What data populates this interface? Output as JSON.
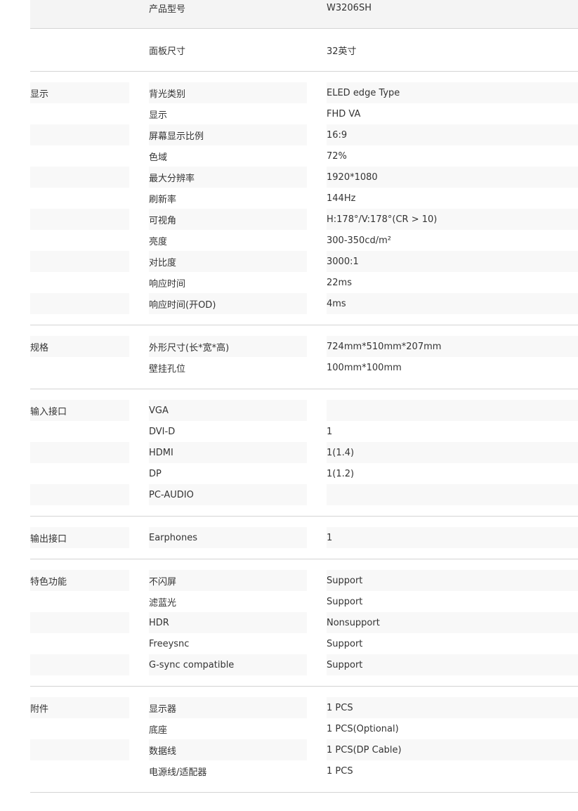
{
  "sections": [
    {
      "kind": "top",
      "label": "",
      "rows": [
        {
          "name": "产品型号",
          "value": "W3206SH"
        }
      ]
    },
    {
      "kind": "panel",
      "label": "",
      "rows": [
        {
          "name": "面板尺寸",
          "value": "32英寸"
        }
      ]
    },
    {
      "kind": "normal",
      "label": "显示",
      "rows": [
        {
          "name": "背光类别",
          "value": "ELED edge Type"
        },
        {
          "name": "显示",
          "value": "FHD VA"
        },
        {
          "name": "屏幕显示比例",
          "value": "16:9"
        },
        {
          "name": "色域",
          "value": "72%"
        },
        {
          "name": "最大分辨率",
          "value": "1920*1080"
        },
        {
          "name": "刷新率",
          "value": "144Hz"
        },
        {
          "name": "可视角",
          "value": "H:178°/V:178°(CR > 10)"
        },
        {
          "name": "亮度",
          "value": "300-350cd/m²"
        },
        {
          "name": "对比度",
          "value": "3000:1"
        },
        {
          "name": "响应时间",
          "value": "22ms"
        },
        {
          "name": "响应时间(开OD)",
          "value": "4ms"
        }
      ]
    },
    {
      "kind": "normal",
      "label": "规格",
      "rows": [
        {
          "name": "外形尺寸(长*宽*高)",
          "value": "724mm*510mm*207mm"
        },
        {
          "name": "壁挂孔位",
          "value": "100mm*100mm"
        }
      ]
    },
    {
      "kind": "normal",
      "label": "输入接口",
      "rows": [
        {
          "name": "VGA",
          "value": ""
        },
        {
          "name": "DVI-D",
          "value": "1"
        },
        {
          "name": "HDMI",
          "value": "1(1.4)"
        },
        {
          "name": "DP",
          "value": "1(1.2)"
        },
        {
          "name": "PC-AUDIO",
          "value": ""
        }
      ]
    },
    {
      "kind": "normal",
      "label": "输出接口",
      "rows": [
        {
          "name": "Earphones",
          "value": "1"
        }
      ]
    },
    {
      "kind": "normal",
      "label": "特色功能",
      "rows": [
        {
          "name": "不闪屏",
          "value": "Support"
        },
        {
          "name": "滤蓝光",
          "value": "Support"
        },
        {
          "name": "HDR",
          "value": "Nonsupport"
        },
        {
          "name": "Freeysnc",
          "value": "Support"
        },
        {
          "name": "G-sync compatible",
          "value": "Support"
        }
      ]
    },
    {
      "kind": "normal",
      "label": "附件",
      "rows": [
        {
          "name": "显示器",
          "value": "1 PCS"
        },
        {
          "name": "底座",
          "value": "1 PCS(Optional)"
        },
        {
          "name": "数据线",
          "value": "1 PCS(DP Cable)"
        },
        {
          "name": "电源线/适配器",
          "value": "1 PCS"
        }
      ]
    }
  ]
}
